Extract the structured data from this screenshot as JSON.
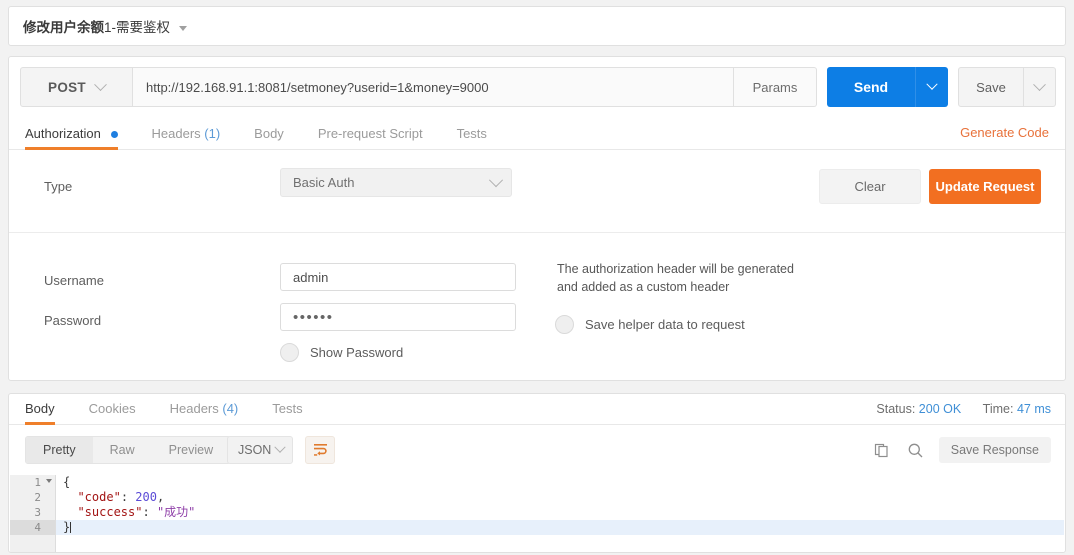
{
  "request_tab": {
    "title_cjk": "修改用户余额",
    "title_rest": "1-需要鉴权",
    "dropdown_icon": "caret-down-icon"
  },
  "url_bar": {
    "method": "POST",
    "method_caret": "chevron-down-icon",
    "url": "http://192.168.91.1:8081/setmoney?userid=1&money=9000",
    "params_label": "Params",
    "send_label": "Send",
    "send_caret": "chevron-down-icon",
    "save_label": "Save",
    "save_caret": "chevron-down-icon"
  },
  "request_tabs": [
    {
      "label": "Authorization",
      "active": true,
      "marker": "blue-dot"
    },
    {
      "label": "Headers",
      "count": "(1)",
      "active": false
    },
    {
      "label": "Body",
      "active": false
    },
    {
      "label": "Pre-request Script",
      "active": false
    },
    {
      "label": "Tests",
      "active": false
    }
  ],
  "generate_code_label": "Generate Code",
  "auth": {
    "type_label": "Type",
    "type_value": "Basic Auth",
    "type_caret": "chevron-down-icon",
    "clear_label": "Clear",
    "update_label": "Update Request",
    "username_label": "Username",
    "username_value": "admin",
    "password_label": "Password",
    "password_value": "••••••",
    "show_password_label": "Show Password",
    "help_line1": "The authorization header will be generated",
    "help_line2": "and added as a custom header",
    "save_helper_label": "Save helper data to request"
  },
  "response_tabs": [
    {
      "label": "Body",
      "active": true
    },
    {
      "label": "Cookies",
      "active": false
    },
    {
      "label": "Headers",
      "count": "(4)",
      "active": false
    },
    {
      "label": "Tests",
      "active": false
    }
  ],
  "response_meta": {
    "status_label": "Status:",
    "status_value": "200 OK",
    "time_label": "Time:",
    "time_value": "47 ms"
  },
  "view_bar": {
    "segments": [
      {
        "label": "Pretty",
        "active": true
      },
      {
        "label": "Raw",
        "active": false
      },
      {
        "label": "Preview",
        "active": false
      }
    ],
    "format_value": "JSON",
    "format_caret": "chevron-down-icon",
    "wrap_icon": "word-wrap-icon",
    "copy_icon": "copy-icon",
    "search_icon": "search-icon",
    "save_response_label": "Save Response"
  },
  "response_body": {
    "lines": [
      {
        "no": "1",
        "foldable": true,
        "current": false
      },
      {
        "no": "2",
        "foldable": false,
        "current": false
      },
      {
        "no": "3",
        "foldable": false,
        "current": false
      },
      {
        "no": "4",
        "foldable": false,
        "current": true
      }
    ],
    "code": {
      "l1_brace": "{",
      "l2_key": "\"code\"",
      "l2_colon": ": ",
      "l2_value": "200",
      "l2_comma": ",",
      "l3_key": "\"success\"",
      "l3_colon": ": ",
      "l3_value": "\"成功\"",
      "l4_brace": "}"
    }
  },
  "colors": {
    "accent_orange": "#ef7f2a",
    "send_blue": "#0d7ee5",
    "update_orange": "#f26f21",
    "link_blue": "#3f8fd6"
  }
}
